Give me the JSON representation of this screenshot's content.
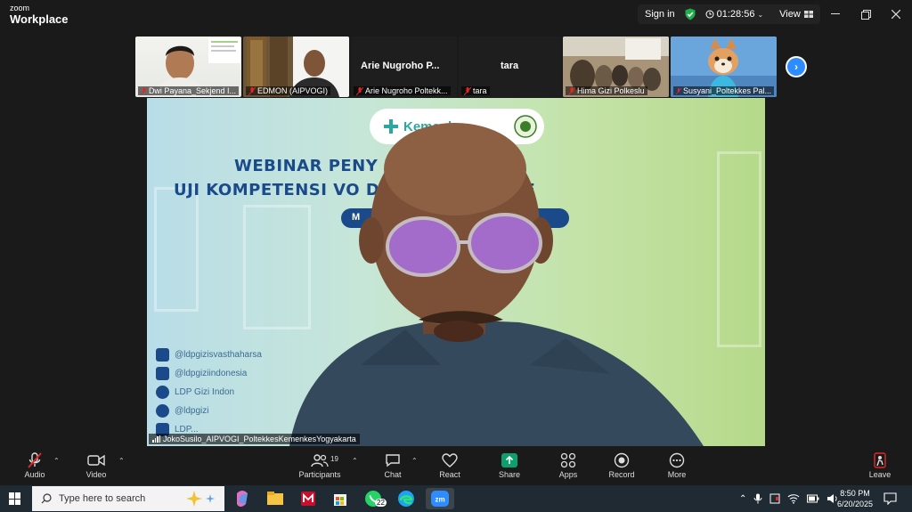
{
  "titlebar": {
    "brand_top": "zoom",
    "brand_main": "Workplace",
    "sign_in": "Sign in",
    "timer": "01:28:56",
    "view": "View"
  },
  "thumbnails": [
    {
      "name": "Dwi Payana_Sekjend I..."
    },
    {
      "name": "EDMON (AIPVOGI)"
    },
    {
      "name": "Arie Nugroho Poltekk...",
      "big_name": "Arie Nugroho P..."
    },
    {
      "name": "tara",
      "big_name": "tara"
    },
    {
      "name": "Hima Gizi Polkeslu"
    },
    {
      "name": "Susyani_Poltekkes Pal..."
    }
  ],
  "main_video": {
    "logo_text": "Kemenkes",
    "banner_line1": "WEBINAR PENY        REVIU SOAL",
    "banner_line2": "UJI KOMPETENSI VO            DE CBT DAN OSCE",
    "pill_text": "M",
    "socials": [
      "@ldpgizisvasthaharsa",
      "@ldpgiziindonesia",
      "LDP Gizi Indon",
      "@ldpgizi",
      "LDP..."
    ],
    "speaker_name": "JokoSusilo_AIPVOGI_PoltekkesKemenkesYogyakarta"
  },
  "toolbar": {
    "audio": "Audio",
    "video": "Video",
    "participants": "Participants",
    "participants_count": "19",
    "chat": "Chat",
    "react": "React",
    "share": "Share",
    "apps": "Apps",
    "record": "Record",
    "more": "More",
    "leave": "Leave"
  },
  "taskbar": {
    "search_placeholder": "Type here to search",
    "whatsapp_badge": "22",
    "time": "8:50 PM",
    "date": "6/20/2025"
  },
  "colors": {
    "share_green": "#0e9f6e",
    "zoom_blue": "#2d8cff",
    "shield_green": "#1fb04b"
  }
}
